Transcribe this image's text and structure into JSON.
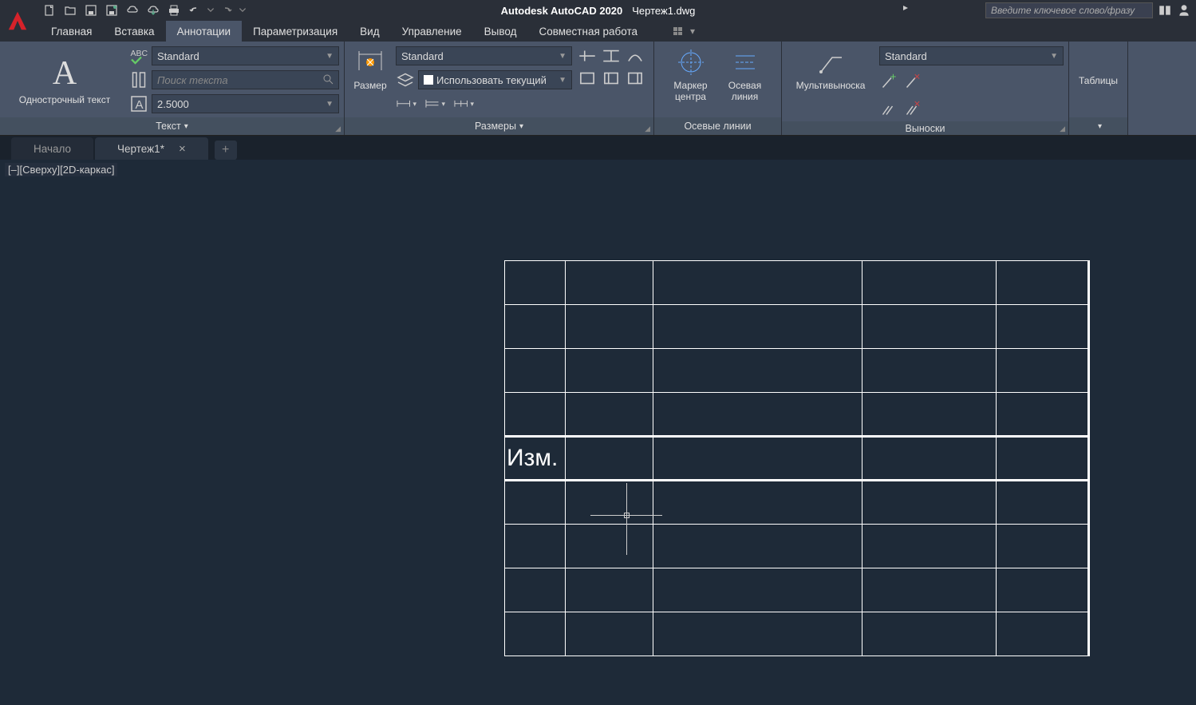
{
  "title": {
    "app": "Autodesk AutoCAD 2020",
    "file": "Чертеж1.dwg",
    "keyword_placeholder": "Введите ключевое слово/фразу"
  },
  "menu": {
    "items": [
      "Главная",
      "Вставка",
      "Аннотации",
      "Параметризация",
      "Вид",
      "Управление",
      "Вывод",
      "Совместная работа"
    ],
    "active_index": 2
  },
  "ribbon": {
    "text": {
      "title": "Текст",
      "big_label": "Однострочный текст",
      "style": "Standard",
      "search_placeholder": "Поиск текста",
      "height": "2.5000"
    },
    "dimensions": {
      "title": "Размеры",
      "big_label": "Размер",
      "style": "Standard",
      "layer": "Использовать текущий"
    },
    "centerlines": {
      "title": "Осевые линии",
      "center_mark": "Маркер центра",
      "centerline": "Осевая линия"
    },
    "leaders": {
      "title": "Выноски",
      "big_label": "Мультивыноска",
      "style": "Standard"
    },
    "tables": {
      "label": "Таблицы"
    }
  },
  "filetabs": {
    "start": "Начало",
    "active": "Чертеж1*"
  },
  "viewport": {
    "label": "[–][Сверху][2D-каркас]"
  },
  "drawing": {
    "cell_text": "Изм."
  }
}
